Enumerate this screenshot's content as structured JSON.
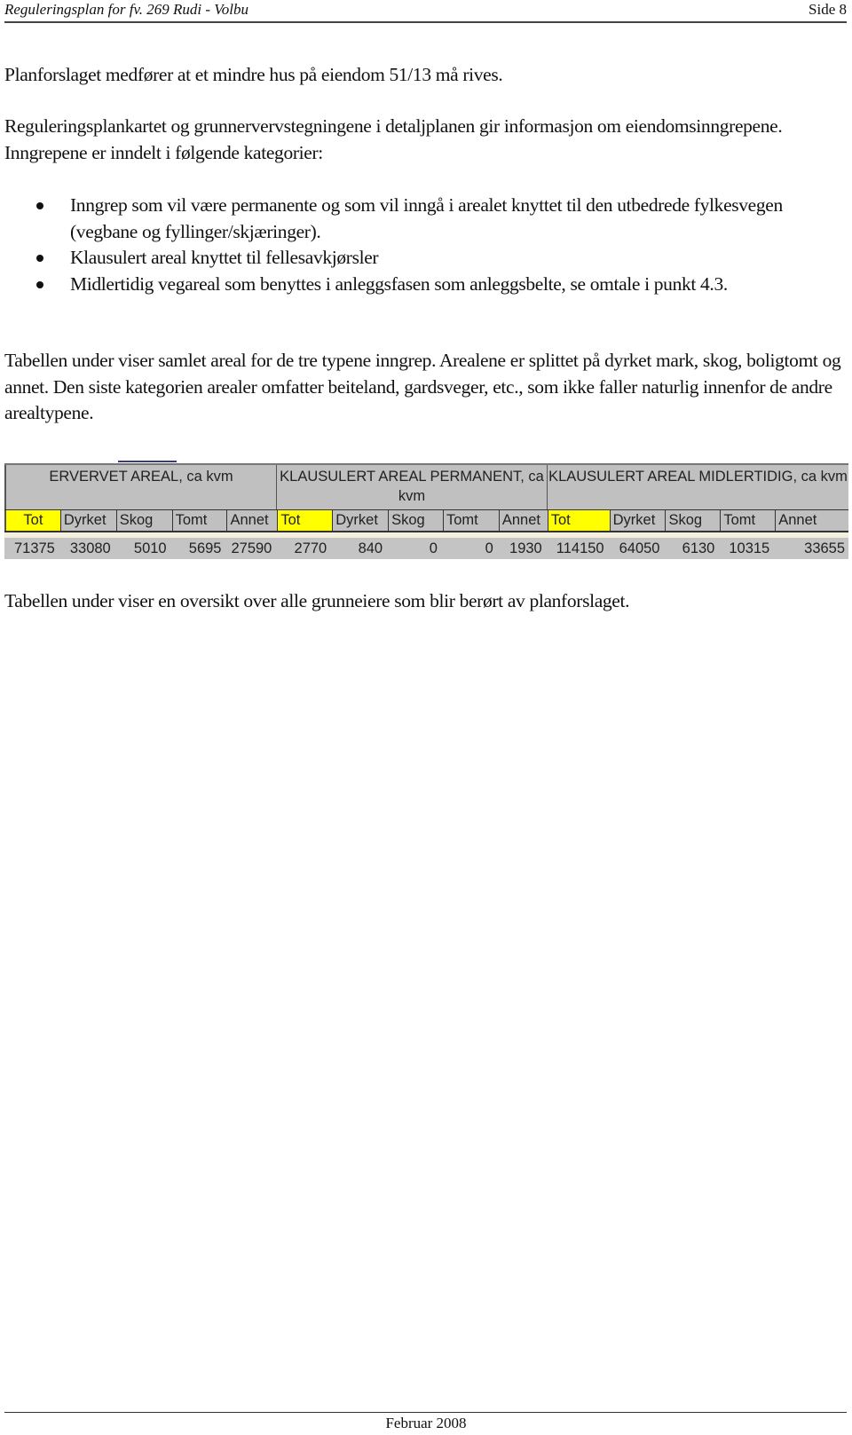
{
  "header": {
    "title": "Reguleringsplan for fv. 269 Rudi - Volbu",
    "page": "Side 8"
  },
  "paragraphs": {
    "p1": "Planforslaget medfører at et mindre hus på eiendom 51/13 må rives.",
    "p2": "Reguleringsplankartet og grunnervervstegningene i detaljplanen gir informasjon om eiendomsinngrepene. Inngrepene er inndelt i følgende kategorier:",
    "p3": "Tabellen under viser samlet areal for de tre typene inngrep. Arealene er splittet på dyrket mark, skog, boligtomt og annet. Den siste kategorien arealer omfatter beiteland, gardsveger, etc., som ikke faller naturlig innenfor de andre arealtypene.",
    "p4": "Tabellen under viser en oversikt over alle grunneiere som blir berørt av planforslaget."
  },
  "bullets": [
    "Inngrep som vil være permanente og som vil inngå i arealet knyttet til den utbedrede fylkesvegen (vegbane og fyllinger/skjæringer).",
    "Klausulert areal knyttet til fellesavkjørsler",
    "Midlertidig vegareal som benyttes i anleggsfasen som anleggsbelte, se omtale i punkt 4.3."
  ],
  "table": {
    "groups": [
      {
        "title": "ERVERVET AREAL, ca kvm",
        "columns": [
          "Tot",
          "Dyrket",
          "Skog",
          "Tomt",
          "Annet"
        ],
        "values": [
          "71375",
          "33080",
          "5010",
          "5695",
          "27590"
        ]
      },
      {
        "title": "KLAUSULERT AREAL PERMANENT, ca kvm",
        "columns": [
          "Tot",
          "Dyrket",
          "Skog",
          "Tomt",
          "Annet"
        ],
        "values": [
          "2770",
          "840",
          "0",
          "0",
          "1930"
        ]
      },
      {
        "title": "KLAUSULERT AREAL MIDLERTIDIG, ca kvm",
        "columns": [
          "Tot",
          "Dyrket",
          "Skog",
          "Tomt",
          "Annet"
        ],
        "values": [
          "114150",
          "64050",
          "6130",
          "10315",
          "33655"
        ]
      }
    ],
    "highlight_color": "#ffff00",
    "header_bg": "#c0c0c0"
  },
  "footer": {
    "date": "Februar 2008"
  }
}
